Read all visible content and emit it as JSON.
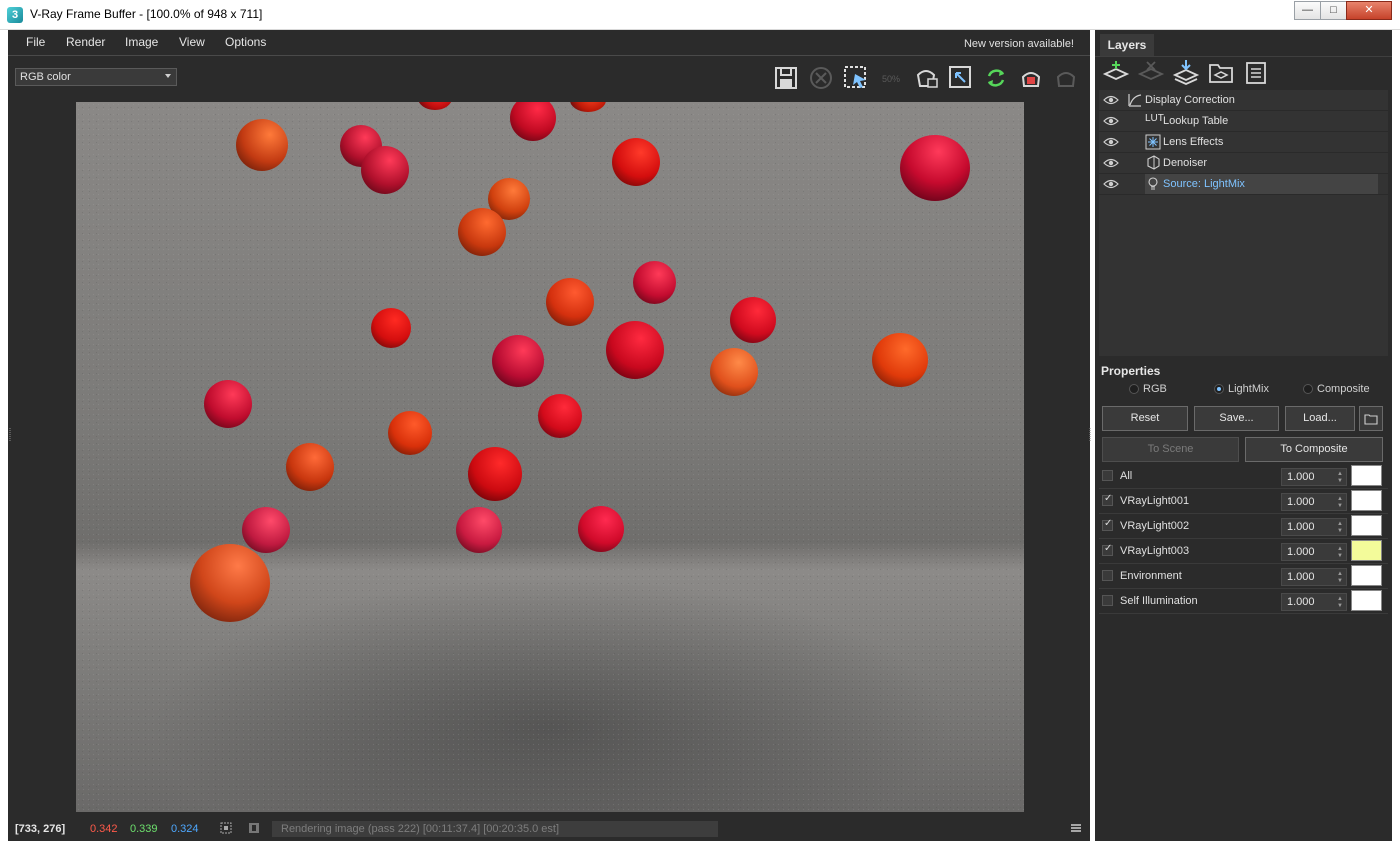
{
  "window": {
    "title": "V-Ray Frame Buffer - [100.0% of 948 x 711]",
    "app_icon": "3",
    "controls": [
      "minimize-icon",
      "maximize-icon",
      "close-icon"
    ]
  },
  "menu": {
    "items": [
      "File",
      "Render",
      "Image",
      "View",
      "Options"
    ],
    "notice": "New version available!"
  },
  "viewer": {
    "channel": "RGB color",
    "toolbar_icons": [
      "save-icon",
      "clear-icon",
      "region-render-icon",
      "zoom-50-icon",
      "track-mouse-icon",
      "region-fit-icon",
      "refresh-icon",
      "render-teapot-icon",
      "interactive-teapot-icon"
    ],
    "zoom_label": "50%"
  },
  "status": {
    "coords": "[733, 276]",
    "r": "0.342",
    "g": "0.339",
    "b": "0.324",
    "progress_text": "Rendering image (pass 222) [00:11:37.4] [00:20:35.0 est]"
  },
  "layers_panel": {
    "tab": "Layers",
    "tool_icons": [
      "create-layer-icon",
      "delete-layer-icon",
      "merge-layer-icon",
      "open-layer-tree-icon",
      "save-layer-tree-icon"
    ],
    "layers": [
      {
        "label": "Display Correction",
        "icon": "curve-icon",
        "icon_text": ""
      },
      {
        "label": "Lookup Table",
        "icon": "lut-icon",
        "icon_text": "LUT"
      },
      {
        "label": "Lens Effects",
        "icon": "lens-effects-icon",
        "icon_text": ""
      },
      {
        "label": "Denoiser",
        "icon": "denoiser-icon",
        "icon_text": ""
      },
      {
        "label": "Source: LightMix",
        "icon": "light-icon",
        "icon_text": ""
      }
    ]
  },
  "properties": {
    "header": "Properties",
    "modes": [
      "RGB",
      "LightMix",
      "Composite"
    ],
    "active_mode": "LightMix",
    "buttons": {
      "reset": "Reset",
      "save": "Save...",
      "load": "Load...",
      "to_scene": "To Scene",
      "to_composite": "To Composite"
    },
    "lights": [
      {
        "name": "All",
        "checked": false,
        "value": "1.000",
        "color": "#ffffff"
      },
      {
        "name": "VRayLight001",
        "checked": true,
        "value": "1.000",
        "color": "#ffffff"
      },
      {
        "name": "VRayLight002",
        "checked": true,
        "value": "1.000",
        "color": "#ffffff"
      },
      {
        "name": "VRayLight003",
        "checked": true,
        "value": "1.000",
        "color": "#f3fb9a"
      },
      {
        "name": "Environment",
        "checked": false,
        "value": "1.000",
        "color": "#ffffff"
      },
      {
        "name": "Self Illumination",
        "checked": false,
        "value": "1.000",
        "color": "#ffffff"
      }
    ]
  },
  "colors": {
    "bg": "#2b2b2b",
    "accent": "#7fc3ff",
    "value_r": "#ff5a4a",
    "value_g": "#6de06d",
    "value_b": "#4ea8ff"
  }
}
